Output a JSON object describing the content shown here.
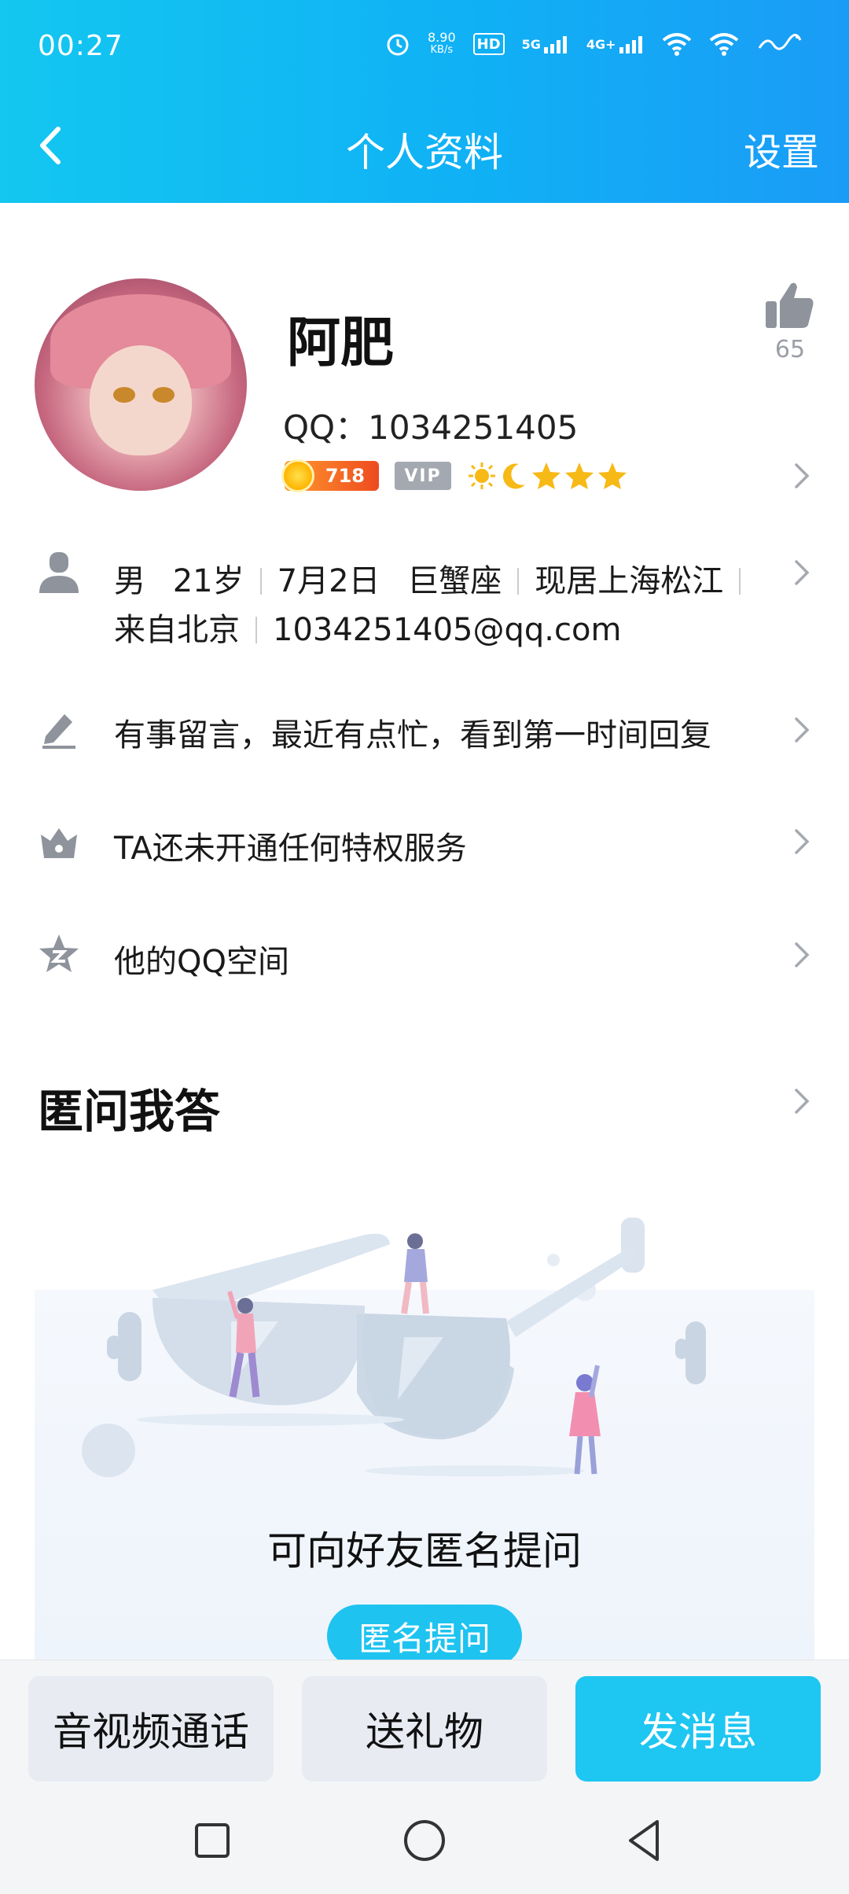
{
  "status_bar": {
    "time": "00:27",
    "speed_value": "8.90",
    "speed_unit": "KB/s",
    "hd_label": "HD",
    "net_5g": "5G",
    "net_4g": "4G+",
    "icons": [
      "alarm-icon",
      "hd-icon",
      "signal-5g-icon",
      "signal-4g-icon",
      "wifi-icon",
      "wifi-icon",
      "battery-icon"
    ]
  },
  "navbar": {
    "title": "个人资料",
    "settings_label": "设置"
  },
  "profile": {
    "name": "阿肥",
    "qq_label": "QQ：",
    "qq_number": "1034251405",
    "level_number": "718",
    "vip_label": "VIP",
    "like_count": "65"
  },
  "details": {
    "gender": "男",
    "age": "21岁",
    "birthday": "7月2日",
    "zodiac": "巨蟹座",
    "location": "现居上海松江",
    "hometown": "来自北京",
    "email": "1034251405@qq.com"
  },
  "rows": {
    "signature": "有事留言，最近有点忙，看到第一时间回复",
    "privilege": "TA还未开通任何特权服务",
    "qzone": "他的QQ空间"
  },
  "qa": {
    "section_title": "匿问我答",
    "prompt": "可向好友匿名提问",
    "button_label": "匿名提问"
  },
  "bottom_actions": {
    "call": "音视频通话",
    "gift": "送礼物",
    "message": "发消息"
  },
  "colors": {
    "header_start": "#13c7f0",
    "header_end": "#1a9cf6",
    "primary": "#1ec6f2"
  }
}
